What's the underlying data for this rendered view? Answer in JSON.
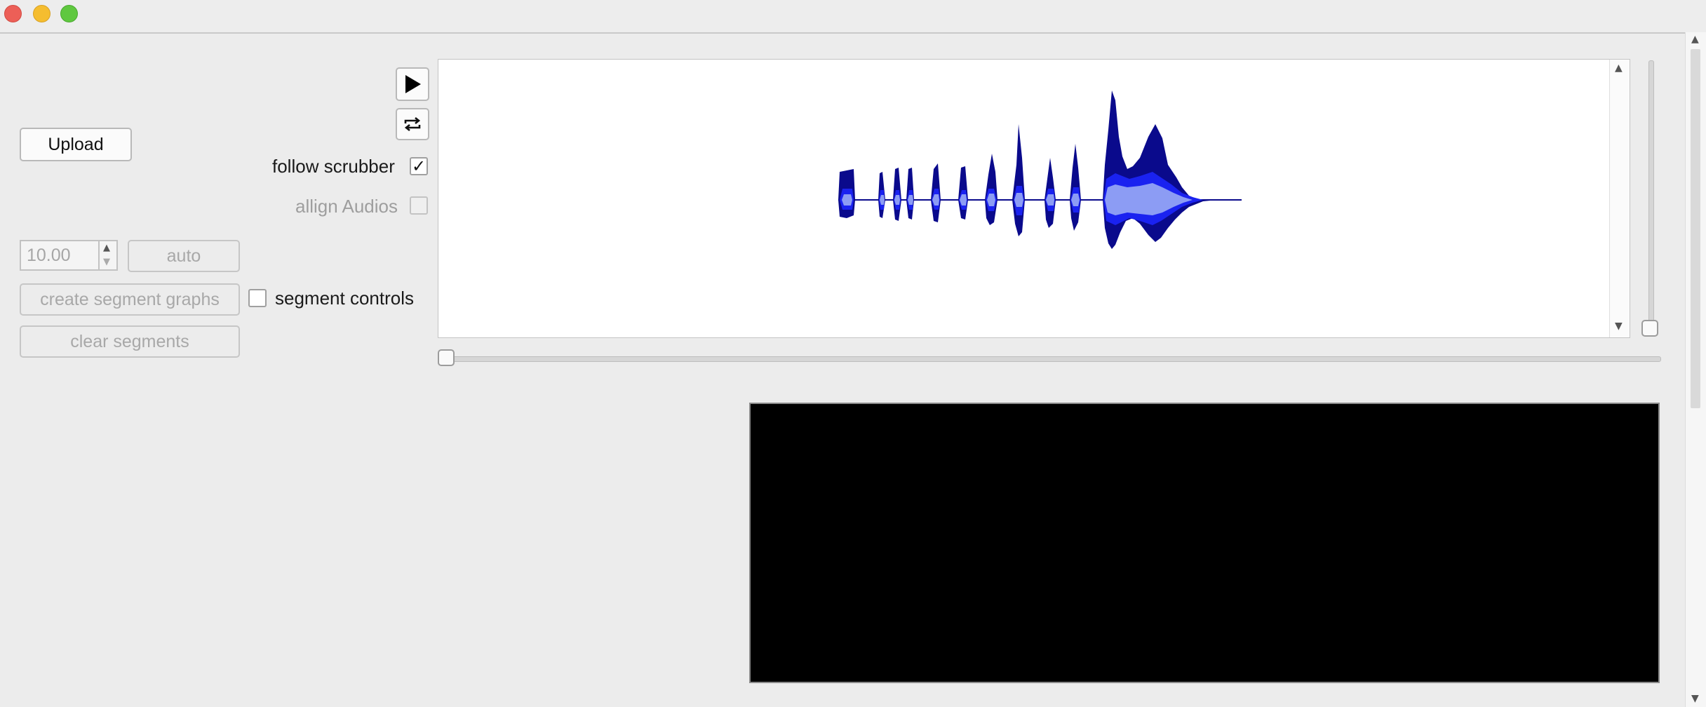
{
  "controls": {
    "upload_label": "Upload",
    "follow_scrubber_label": "follow scrubber",
    "follow_scrubber_checked": true,
    "align_audios_label": "allign Audios",
    "align_audios_checked": false,
    "segment_length_value": "10.00",
    "auto_label": "auto",
    "create_segment_graphs_label": "create segment graphs",
    "segment_controls_label": "segment controls",
    "segment_controls_checked": false,
    "clear_segments_label": "clear segments",
    "check_mark": "✓"
  },
  "icons": {
    "play": "play-icon",
    "loop": "loop-icon"
  },
  "colors": {
    "waveform_dark": "#0a0a8c",
    "waveform_mid": "#1a22f0",
    "waveform_light": "#8c9cf4",
    "spectrogram_bg": "#000000"
  }
}
